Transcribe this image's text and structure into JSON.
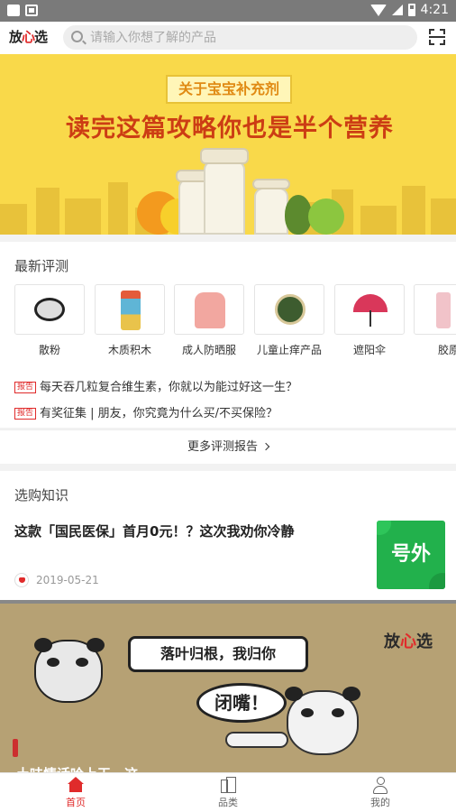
{
  "status_bar": {
    "time": "4:21"
  },
  "header": {
    "logo_pre": "放",
    "logo_heart": "心",
    "logo_post": "选",
    "search_placeholder": "请输入你想了解的产品"
  },
  "banner": {
    "tag": "关于宝宝补充剂",
    "title": "读完这篇攻略你也是半个营养师！"
  },
  "reviews": {
    "title": "最新评测",
    "products": [
      {
        "name": "散粉",
        "icon": "compact-powder-icon"
      },
      {
        "name": "木质积木",
        "icon": "wooden-blocks-jar-icon"
      },
      {
        "name": "成人防晒服",
        "icon": "sun-jacket-icon"
      },
      {
        "name": "儿童止痒产品",
        "icon": "ointment-tin-icon"
      },
      {
        "name": "遮阳伞",
        "icon": "umbrella-icon"
      },
      {
        "name": "胶原",
        "icon": "collagen-bottle-icon"
      }
    ],
    "report_tag": "报告",
    "reports": [
      "每天吞几粒复合维生素，你就以为能过好这一生？",
      "有奖征集 | 朋友，你究竟为什么买/不买保险？"
    ],
    "more_label": "更多评测报告"
  },
  "knowledge": {
    "title": "选购知识",
    "article": {
      "title": "这款「国民医保」首月0元！？这次我劝你冷静",
      "date": "2019-05-21",
      "thumb_text": "号外"
    }
  },
  "meme": {
    "bubble1": "落叶归根，我归你",
    "bubble2": "闭嘴！",
    "logo_pre": "放",
    "logo_heart": "心",
    "logo_post": "选",
    "caption": "土味情话哈上天，这"
  },
  "bottom_nav": [
    {
      "label": "首页",
      "icon": "home-icon",
      "active": true
    },
    {
      "label": "品类",
      "icon": "category-icon",
      "active": false
    },
    {
      "label": "我的",
      "icon": "profile-icon",
      "active": false
    }
  ],
  "colors": {
    "accent_red": "#e02b2b",
    "banner_yellow": "#f9d94a",
    "banner_title": "#cc3d14",
    "thumb_green": "#22b14c"
  }
}
